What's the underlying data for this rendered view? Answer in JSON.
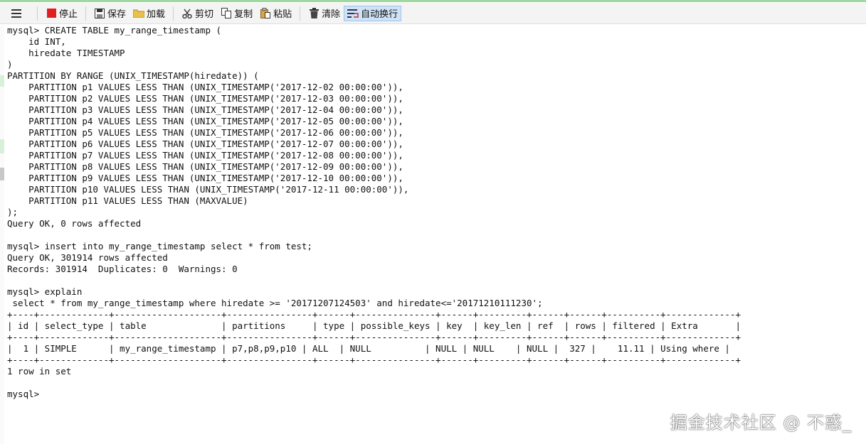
{
  "toolbar": {
    "stop_label": "停止",
    "save_label": "保存",
    "load_label": "加载",
    "cut_label": "剪切",
    "copy_label": "复制",
    "paste_label": "粘贴",
    "clear_label": "清除",
    "wrap_label": "自动换行"
  },
  "colors": {
    "stop_red": "#e02020",
    "toolbar_bg": "#f4f4f4",
    "active_bg": "#cfe3f7",
    "accent_green": "#9fd99f"
  },
  "icons": [
    "menu-icon",
    "stop-icon",
    "save-icon",
    "load-icon",
    "cut-icon",
    "copy-icon",
    "paste-icon",
    "clear-icon",
    "wrap-icon"
  ],
  "console": {
    "lines": [
      "mysql> CREATE TABLE my_range_timestamp (",
      "    id INT,",
      "    hiredate TIMESTAMP",
      ")",
      "PARTITION BY RANGE (UNIX_TIMESTAMP(hiredate)) (",
      "    PARTITION p1 VALUES LESS THAN (UNIX_TIMESTAMP('2017-12-02 00:00:00')),",
      "    PARTITION p2 VALUES LESS THAN (UNIX_TIMESTAMP('2017-12-03 00:00:00')),",
      "    PARTITION p3 VALUES LESS THAN (UNIX_TIMESTAMP('2017-12-04 00:00:00')),",
      "    PARTITION p4 VALUES LESS THAN (UNIX_TIMESTAMP('2017-12-05 00:00:00')),",
      "    PARTITION p5 VALUES LESS THAN (UNIX_TIMESTAMP('2017-12-06 00:00:00')),",
      "    PARTITION p6 VALUES LESS THAN (UNIX_TIMESTAMP('2017-12-07 00:00:00')),",
      "    PARTITION p7 VALUES LESS THAN (UNIX_TIMESTAMP('2017-12-08 00:00:00')),",
      "    PARTITION p8 VALUES LESS THAN (UNIX_TIMESTAMP('2017-12-09 00:00:00')),",
      "    PARTITION p9 VALUES LESS THAN (UNIX_TIMESTAMP('2017-12-10 00:00:00')),",
      "    PARTITION p10 VALUES LESS THAN (UNIX_TIMESTAMP('2017-12-11 00:00:00')),",
      "    PARTITION p11 VALUES LESS THAN (MAXVALUE)",
      ");",
      "Query OK, 0 rows affected",
      "",
      "mysql> insert into my_range_timestamp select * from test;",
      "Query OK, 301914 rows affected",
      "Records: 301914  Duplicates: 0  Warnings: 0",
      "",
      "mysql> explain",
      " select * from my_range_timestamp where hiredate >= '20171207124503' and hiredate<='20171210111230';",
      "+----+-------------+--------------------+----------------+------+---------------+------+---------+------+------+----------+-------------+",
      "| id | select_type | table              | partitions     | type | possible_keys | key  | key_len | ref  | rows | filtered | Extra       |",
      "+----+-------------+--------------------+----------------+------+---------------+------+---------+------+------+----------+-------------+",
      "|  1 | SIMPLE      | my_range_timestamp | p7,p8,p9,p10 | ALL  | NULL          | NULL | NULL    | NULL |  327 |    11.11 | Using where |",
      "+----+-------------+--------------------+----------------+------+---------------+------+---------+------+------+----------+-------------+",
      "1 row in set",
      "",
      "mysql>"
    ]
  },
  "watermark": "掘金技术社区 @ 不惑_"
}
